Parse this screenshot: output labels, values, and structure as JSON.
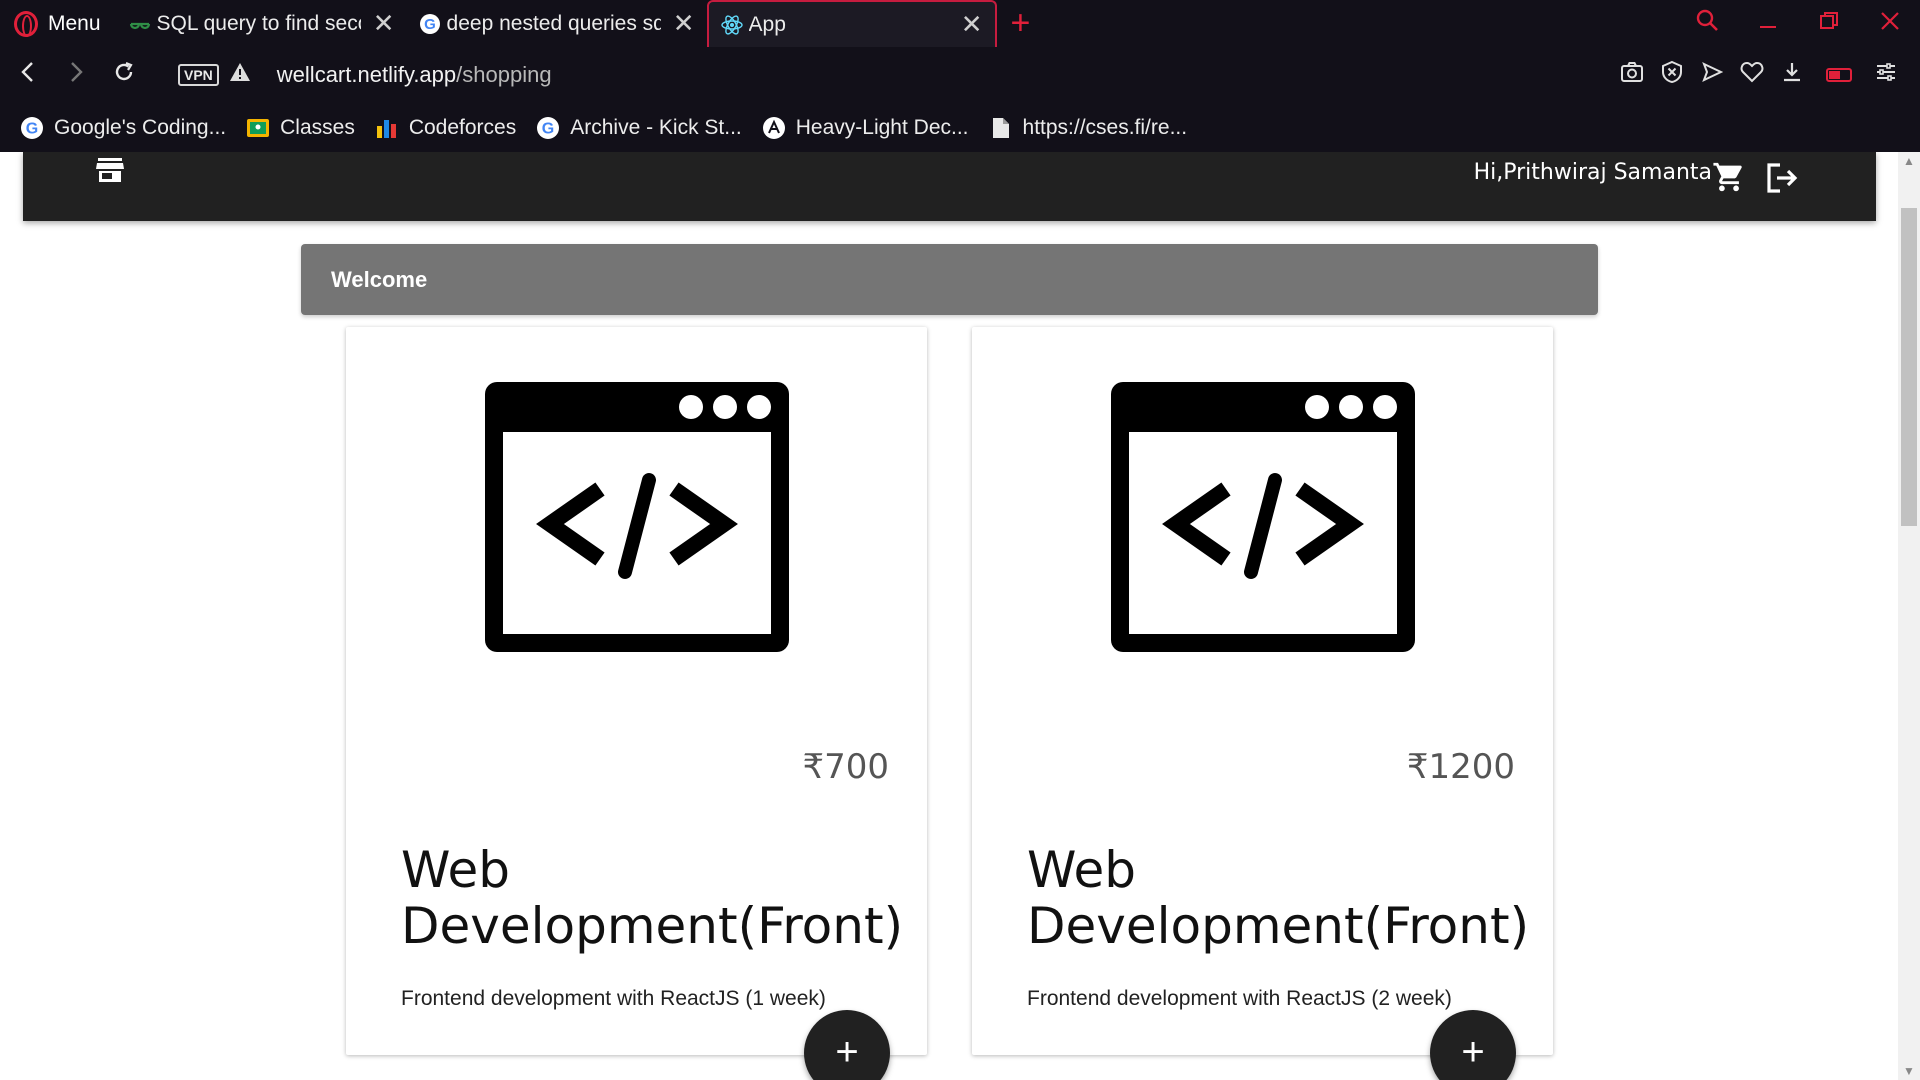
{
  "browser": {
    "menu_label": "Menu",
    "tabs": [
      {
        "title": "SQL query to find seco",
        "favicon": "geeksforgeeks-icon"
      },
      {
        "title": "deep nested queries sq",
        "favicon": "google-icon"
      },
      {
        "title": "App",
        "favicon": "react-icon",
        "active": true
      }
    ],
    "vpn_label": "VPN",
    "url_host": "wellcart.netlify.app",
    "url_path": "/shopping",
    "bookmarks": [
      {
        "label": "Google's Coding...",
        "icon": "google-icon"
      },
      {
        "label": "Classes",
        "icon": "classroom-icon"
      },
      {
        "label": "Codeforces",
        "icon": "codeforces-icon"
      },
      {
        "label": "Archive - Kick St...",
        "icon": "google-icon"
      },
      {
        "label": "Heavy-Light Dec...",
        "icon": "atcoder-icon"
      },
      {
        "label": "https://cses.fi/re...",
        "icon": "document-icon"
      }
    ],
    "accent_color": "#e0203a"
  },
  "header": {
    "greeting": "Hi,Prithwiraj Samanta",
    "background": "#212121"
  },
  "banner": {
    "title": "Welcome",
    "background": "#757575"
  },
  "products": [
    {
      "price": "₹700",
      "name": "Web Development(Front)",
      "description": "Frontend development with ReactJS (1 week)",
      "icon": "code-window-icon",
      "add_label": "+"
    },
    {
      "price": "₹1200",
      "name": "Web Development(Front)",
      "description": "Frontend development with ReactJS (2 week)",
      "icon": "code-window-icon",
      "add_label": "+"
    }
  ]
}
